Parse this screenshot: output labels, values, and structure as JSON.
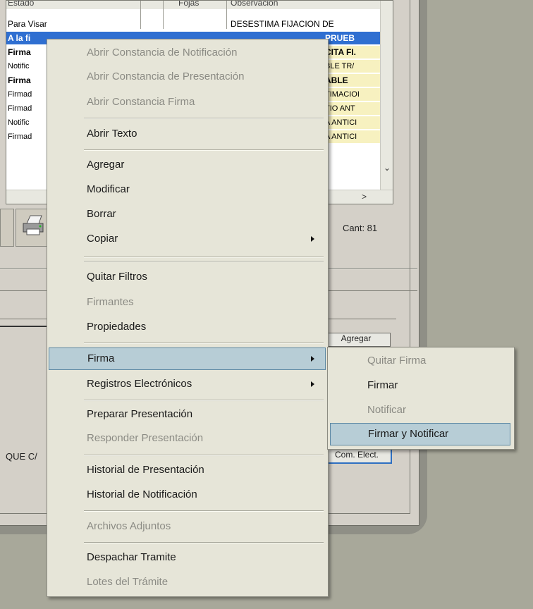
{
  "grid": {
    "header": {
      "col1": "Estado",
      "col2": "Fojas",
      "col3": "Observacion"
    },
    "rows": [
      {
        "col1": "Para Visar",
        "col3": "DESESTIMA FIJACION DE",
        "bold": false
      },
      {
        "col1": "A la fi",
        "col3": "PRUEB",
        "bold": true,
        "selected": true
      },
      {
        "col1": "Firma",
        "col3": "CITA FI.",
        "bold": true
      },
      {
        "col1": "Notific",
        "col3": "BLE TR/",
        "bold": false
      },
      {
        "col1": "Firma",
        "col3": "ABLE",
        "bold": true
      },
      {
        "col1": "Firmad",
        "col3": "TIMACIOI",
        "bold": false
      },
      {
        "col1": "Firmad",
        "col3": "TIO ANT",
        "bold": false
      },
      {
        "col1": "Notific",
        "col3": "A ANTICI",
        "bold": false
      },
      {
        "col1": "Firmad",
        "col3": "A ANTICI",
        "bold": false
      }
    ],
    "scroll_down_glyph": "⌄",
    "scroll_right_glyph": ">"
  },
  "count_label": "Cant: 81",
  "side_buttons": {
    "agregar": "Agregar",
    "com_elect": "Com. Elect."
  },
  "truncated_text": "QUE C/",
  "context_menu": {
    "items": [
      {
        "label": "Abrir Constancia de Notificación",
        "disabled": true
      },
      {
        "label": "Abrir Constancia de Presentación",
        "disabled": true
      },
      {
        "label": "Abrir Constancia Firma",
        "disabled": true
      },
      {
        "label": "Abrir Texto",
        "disabled": false
      },
      {
        "label": "Agregar",
        "disabled": false
      },
      {
        "label": "Modificar",
        "disabled": false
      },
      {
        "label": "Borrar",
        "disabled": false
      },
      {
        "label": "Copiar",
        "disabled": false,
        "submenu": true
      },
      {
        "label": "Quitar Filtros",
        "disabled": false
      },
      {
        "label": "Firmantes",
        "disabled": true
      },
      {
        "label": "Propiedades",
        "disabled": false
      },
      {
        "label": "Firma",
        "disabled": false,
        "submenu": true,
        "highlighted": true
      },
      {
        "label": "Registros Electrónicos",
        "disabled": false,
        "submenu": true
      },
      {
        "label": "Preparar Presentación",
        "disabled": false
      },
      {
        "label": "Responder Presentación",
        "disabled": true
      },
      {
        "label": "Historial de Presentación",
        "disabled": false
      },
      {
        "label": "Historial de Notificación",
        "disabled": false
      },
      {
        "label": "Archivos Adjuntos",
        "disabled": true
      },
      {
        "label": "Despachar Tramite",
        "disabled": false
      },
      {
        "label": "Lotes del Trámite",
        "disabled": true
      }
    ]
  },
  "submenu_firma": {
    "items": [
      {
        "label": "Quitar Firma",
        "disabled": true
      },
      {
        "label": "Firmar",
        "disabled": false
      },
      {
        "label": "Notificar",
        "disabled": true
      },
      {
        "label": "Firmar y Notificar",
        "disabled": false,
        "highlighted": true
      }
    ]
  },
  "colors": {
    "menu_bg": "#e6e5d8",
    "highlight_bg": "#b7cdd6",
    "highlight_border": "#5b87a3",
    "selected_row": "#2f6fd1",
    "yellow_cell": "#f7f1c0"
  }
}
